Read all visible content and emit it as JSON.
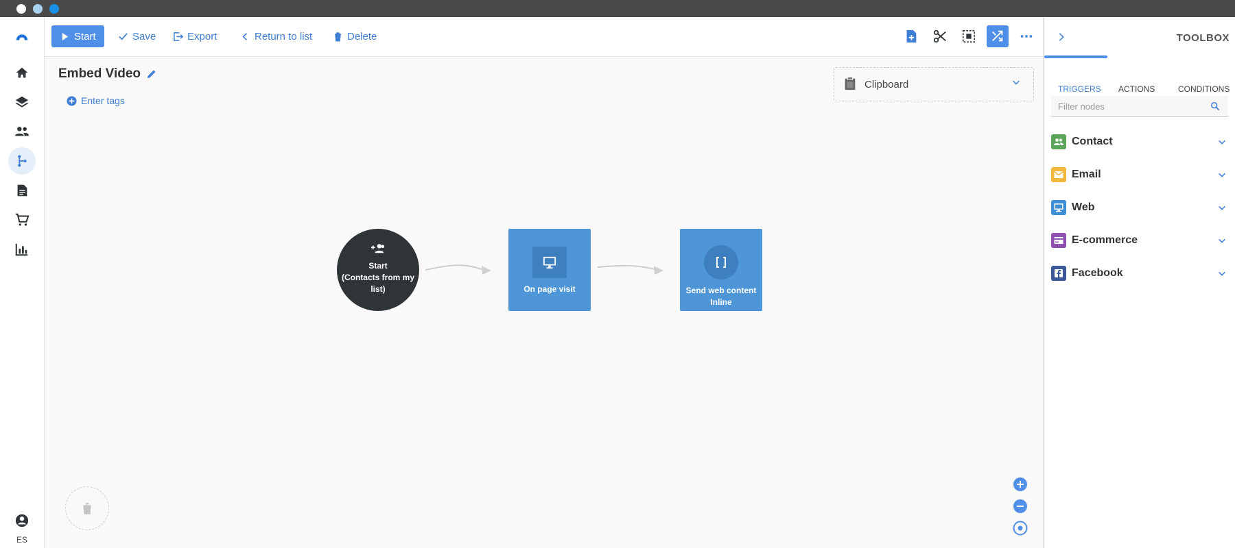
{
  "toolbar": {
    "start_label": "Start",
    "save_label": "Save",
    "export_label": "Export",
    "return_label": "Return to list",
    "delete_label": "Delete"
  },
  "canvas": {
    "title": "Embed Video",
    "tags_label": "Enter tags",
    "clipboard_label": "Clipboard",
    "nodes": [
      {
        "label_line1": "Start",
        "label_line2": "(Contacts from my list)",
        "icon": "add-group-icon"
      },
      {
        "label_line1": "On page visit",
        "label_line2": "",
        "icon": "monitor-icon"
      },
      {
        "label_line1": "Send web content",
        "label_line2": "Inline",
        "icon": "brackets-icon"
      }
    ]
  },
  "sidebar": {
    "items": [
      "logo",
      "home-icon",
      "layers-icon",
      "people-icon",
      "flow-icon",
      "document-icon",
      "cart-icon",
      "chart-icon"
    ],
    "language": "ES"
  },
  "toolbox": {
    "title": "TOOLBOX",
    "tabs": [
      "TRIGGERS",
      "ACTIONS",
      "CONDITIONS"
    ],
    "filter_placeholder": "Filter nodes",
    "categories": [
      {
        "label": "Contact",
        "color": "#5aa55a"
      },
      {
        "label": "Email",
        "color": "#f0b73c"
      },
      {
        "label": "Web",
        "color": "#3f8fd6"
      },
      {
        "label": "E-commerce",
        "color": "#8e4fae"
      },
      {
        "label": "Facebook",
        "color": "#3b5998"
      }
    ]
  },
  "colors": {
    "accent": "#4f8fe8",
    "node_blue": "#4e96d8",
    "node_dark": "#2f3437"
  }
}
